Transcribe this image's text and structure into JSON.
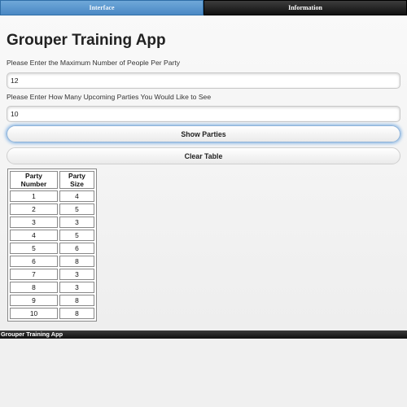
{
  "navbar": {
    "tabs": [
      {
        "label": "Interface",
        "active": true
      },
      {
        "label": "Information",
        "active": false
      }
    ]
  },
  "main": {
    "title": "Grouper Training App",
    "max_people_label": "Please Enter the Maximum Number of People Per Party",
    "max_people_value": "12",
    "parties_label": "Please Enter How Many Upcoming Parties You Would Like to See",
    "parties_value": "10",
    "show_button": "Show Parties",
    "clear_button": "Clear Table"
  },
  "table": {
    "headers": [
      "Party Number",
      "Party Size"
    ],
    "rows": [
      [
        "1",
        "4"
      ],
      [
        "2",
        "5"
      ],
      [
        "3",
        "3"
      ],
      [
        "4",
        "5"
      ],
      [
        "5",
        "6"
      ],
      [
        "6",
        "8"
      ],
      [
        "7",
        "3"
      ],
      [
        "8",
        "3"
      ],
      [
        "9",
        "8"
      ],
      [
        "10",
        "8"
      ]
    ]
  },
  "footer": {
    "text": "Grouper Training App"
  },
  "colors": {
    "active_tab": "#4a88c4",
    "inactive_tab": "#111111",
    "focus_glow": "#7aaee3"
  }
}
